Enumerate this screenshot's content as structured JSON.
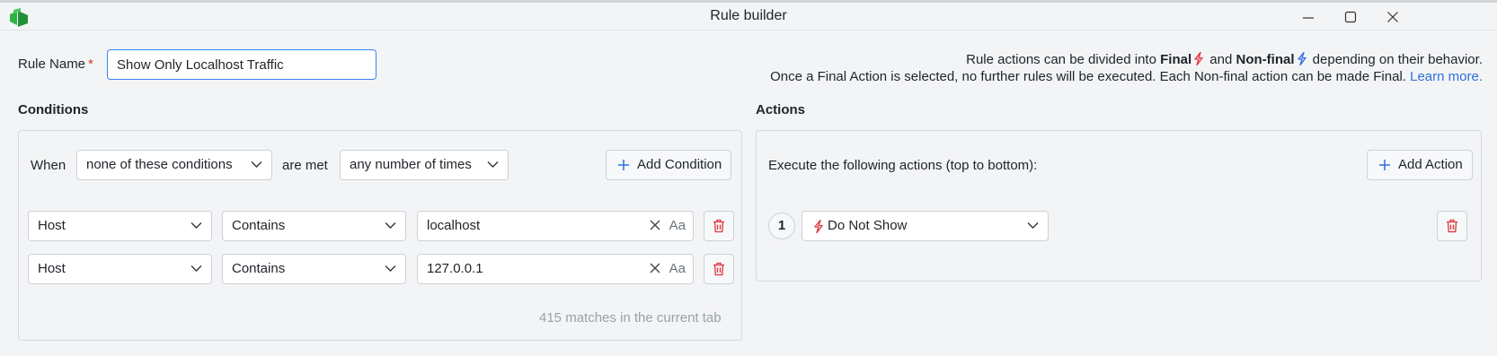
{
  "window": {
    "title": "Rule builder",
    "controls": [
      "minimize",
      "maximize",
      "close"
    ]
  },
  "rule_name": {
    "label": "Rule Name",
    "required_mark": "*",
    "value": "Show Only Localhost Traffic"
  },
  "help": {
    "line1_prefix": "Rule actions can be divided into",
    "final_label": "Final",
    "and": "and",
    "nonfinal_label": "Non-final",
    "line1_suffix": "depending on their behavior.",
    "line2": "Once a Final Action is selected, no further rules will be executed. Each Non-final action can be made Final.",
    "learn_more": "Learn more."
  },
  "conditions": {
    "title": "Conditions",
    "when_label": "When",
    "match_mode": "none of these conditions",
    "are_met_label": "are met",
    "frequency": "any number of times",
    "add_button": "Add Condition",
    "rows": [
      {
        "field": "Host",
        "operator": "Contains",
        "value": "localhost",
        "case_toggle": "Aa"
      },
      {
        "field": "Host",
        "operator": "Contains",
        "value": "127.0.0.1",
        "case_toggle": "Aa"
      }
    ],
    "matches_text": "415 matches in the current tab"
  },
  "actions": {
    "title": "Actions",
    "execute_label": "Execute the following actions (top to bottom):",
    "add_button": "Add Action",
    "items": [
      {
        "step": "1",
        "action": "Do Not Show",
        "kind": "final"
      }
    ]
  },
  "colors": {
    "final_bolt": "#e0333a",
    "nonfinal_bolt": "#2f6fde",
    "link": "#2f6fde",
    "focus_border": "#3b82f6",
    "trash": "#e0333a",
    "logo": "#2fb344"
  }
}
